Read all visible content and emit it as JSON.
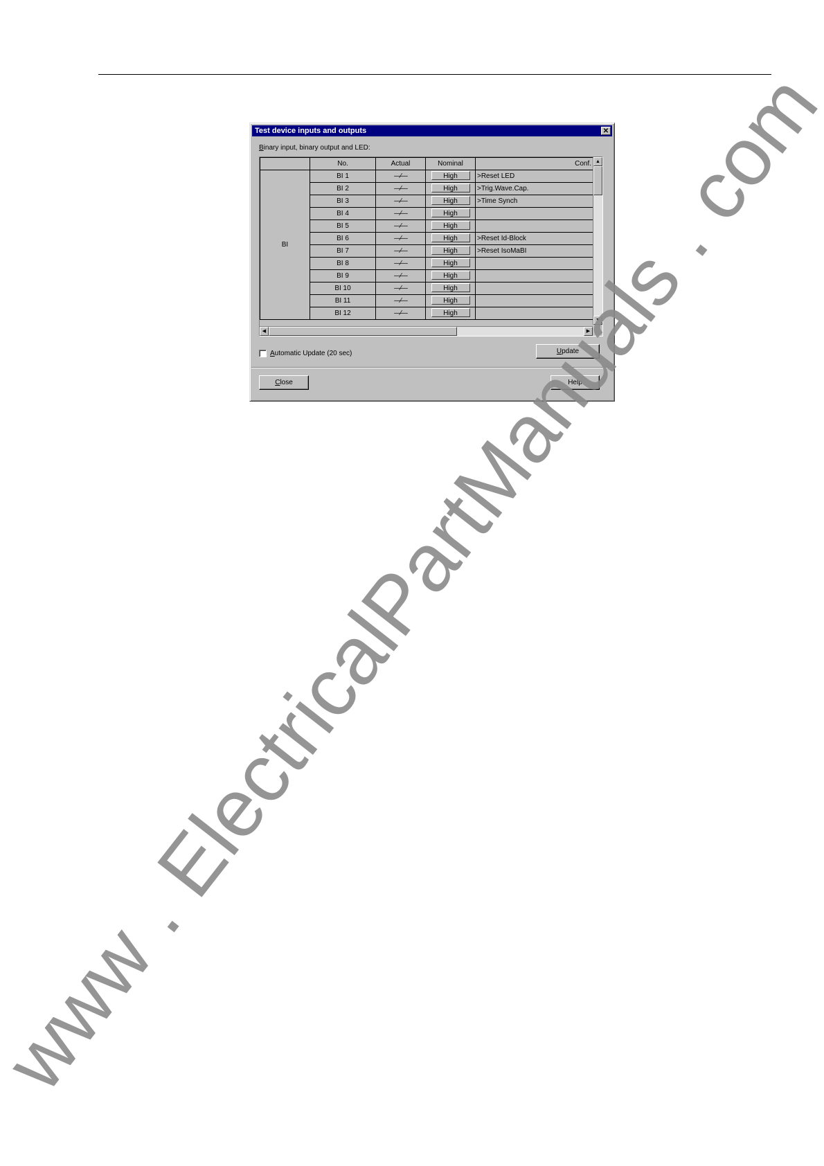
{
  "dialog": {
    "title": "Test device inputs and outputs",
    "close_glyph": "✕",
    "group_label_accel": "B",
    "group_label_rest": "inary input, binary output and LED:",
    "grid": {
      "headers": {
        "group": "",
        "no": "No.",
        "actual": "Actual",
        "nominal": "Nominal",
        "conf": "Conf."
      },
      "group_label": "BI",
      "actual_symbol": "⁄",
      "rows": [
        {
          "no": "BI 1",
          "actual": "—⁄—",
          "nominal": "High",
          "conf": ">Reset LED"
        },
        {
          "no": "BI 2",
          "actual": "—⁄—",
          "nominal": "High",
          "conf": ">Trig.Wave.Cap."
        },
        {
          "no": "BI 3",
          "actual": "—⁄—",
          "nominal": "High",
          "conf": ">Time Synch"
        },
        {
          "no": "BI 4",
          "actual": "—⁄—",
          "nominal": "High",
          "conf": ""
        },
        {
          "no": "BI 5",
          "actual": "—⁄—",
          "nominal": "High",
          "conf": ""
        },
        {
          "no": "BI 6",
          "actual": "—⁄—",
          "nominal": "High",
          "conf": ">Reset Id-Block"
        },
        {
          "no": "BI 7",
          "actual": "—⁄—",
          "nominal": "High",
          "conf": ">Reset IsoMaBI"
        },
        {
          "no": "BI 8",
          "actual": "—⁄—",
          "nominal": "High",
          "conf": ""
        },
        {
          "no": "BI 9",
          "actual": "—⁄—",
          "nominal": "High",
          "conf": ""
        },
        {
          "no": "BI 10",
          "actual": "—⁄—",
          "nominal": "High",
          "conf": ""
        },
        {
          "no": "BI 11",
          "actual": "—⁄—",
          "nominal": "High",
          "conf": ""
        },
        {
          "no": "BI 12",
          "actual": "—⁄—",
          "nominal": "High",
          "conf": ""
        }
      ]
    },
    "auto_update_accel": "A",
    "auto_update_rest": "utomatic Update (20 sec)",
    "update_button_accel": "U",
    "update_button_rest": "pdate",
    "close_button_accel": "C",
    "close_button_rest": "lose",
    "help_button": "Help"
  },
  "watermark": "www . ElectricalPartManuals . com"
}
